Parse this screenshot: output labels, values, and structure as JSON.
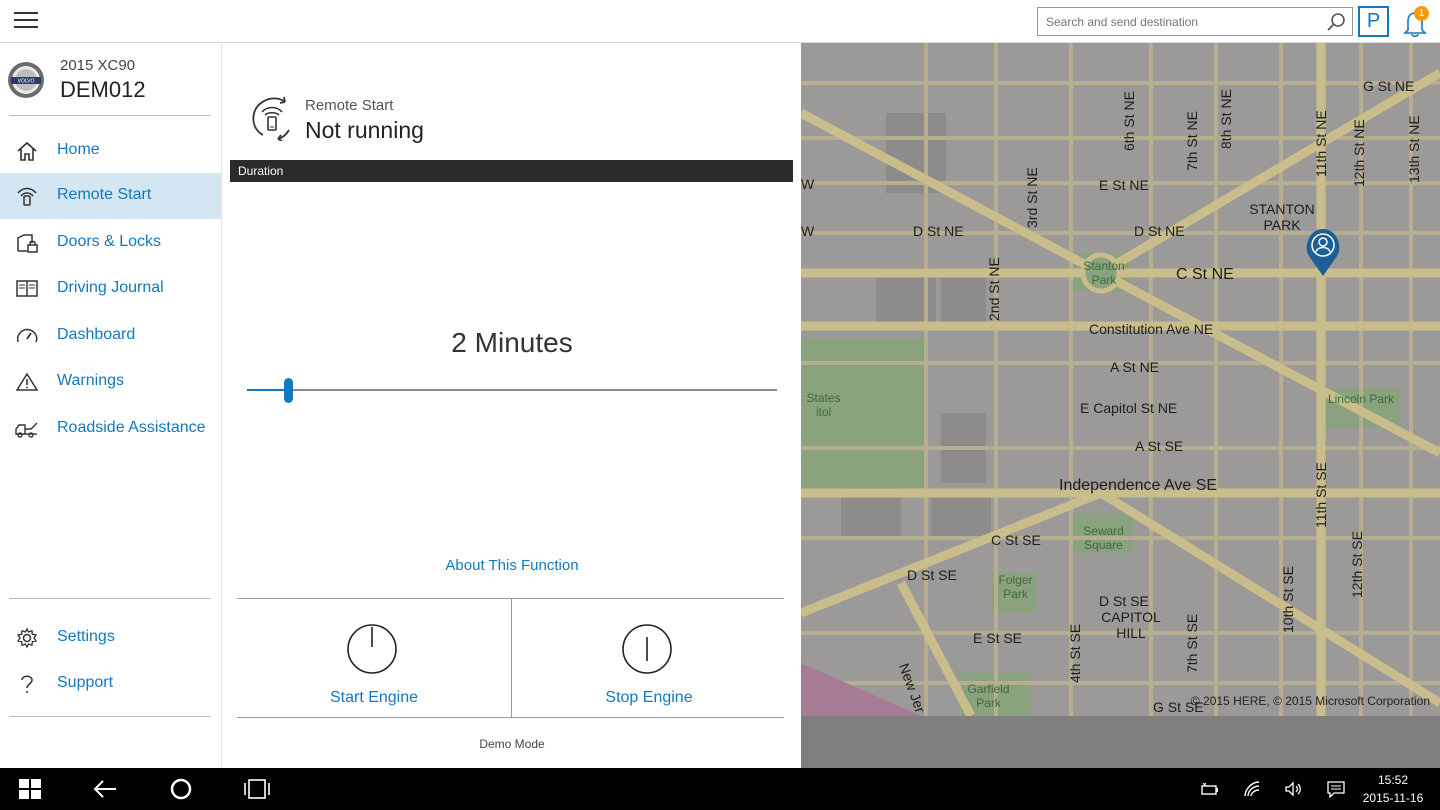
{
  "topbar": {
    "search_placeholder": "Search and send destination",
    "parking_label": "P",
    "notification_count": "1"
  },
  "car": {
    "model": "2015 XC90",
    "plate": "DEM012"
  },
  "nav": {
    "items": [
      {
        "label": "Home",
        "icon": "home-icon"
      },
      {
        "label": "Remote Start",
        "icon": "remote-start-icon",
        "active": true
      },
      {
        "label": "Doors & Locks",
        "icon": "lock-icon"
      },
      {
        "label": "Driving Journal",
        "icon": "journal-icon"
      },
      {
        "label": "Dashboard",
        "icon": "gauge-icon"
      },
      {
        "label": "Warnings",
        "icon": "warning-icon"
      },
      {
        "label": "Roadside Assistance",
        "icon": "tow-truck-icon"
      }
    ],
    "bottom_items": [
      {
        "label": "Settings",
        "icon": "gear-icon"
      },
      {
        "label": "Support",
        "icon": "question-icon"
      }
    ]
  },
  "remote_start": {
    "title": "Remote Start",
    "status": "Not running",
    "duration_header": "Duration",
    "duration_value": "2 Minutes",
    "slider_fraction": 0.077,
    "about_link": "About This Function",
    "start_label": "Start Engine",
    "stop_label": "Stop Engine",
    "demo_mode": "Demo Mode"
  },
  "map": {
    "streets": [
      "G St NE",
      "6th St NE",
      "7th St NE",
      "8th St NE",
      "11th St NE",
      "12th St NE",
      "13th St NE",
      "3rd St NE",
      "E St NE",
      "D St NE",
      "D St NE",
      "2nd St NE",
      "C St NE",
      "Constitution Ave NE",
      "A St NE",
      "E Capitol St NE",
      "A St SE",
      "Independence Ave SE",
      "11th St SE",
      "C St SE",
      "D St SE",
      "D St SE",
      "E St SE",
      "4th St SE",
      "7th St SE",
      "10th St SE",
      "12th St SE",
      "New Jer",
      "G St SE",
      "W",
      "W"
    ],
    "places": [
      "STANTON PARK",
      "CAPITOL HILL",
      "Stanton Park",
      "Lincoln Park",
      "Seward Square",
      "Folger Park",
      "Garfield Park",
      "States itol"
    ],
    "copyright": "© 2015 HERE, © 2015 Microsoft Corporation",
    "colors": {
      "land": "#9c9a98",
      "road": "#c9bd8c",
      "park": "#8aa27e"
    }
  },
  "taskbar": {
    "time": "15:52",
    "date": "2015-11-16"
  },
  "colors": {
    "accent": "#1478be",
    "nav_active": "#d5e6f3",
    "badge": "#f39c12"
  }
}
